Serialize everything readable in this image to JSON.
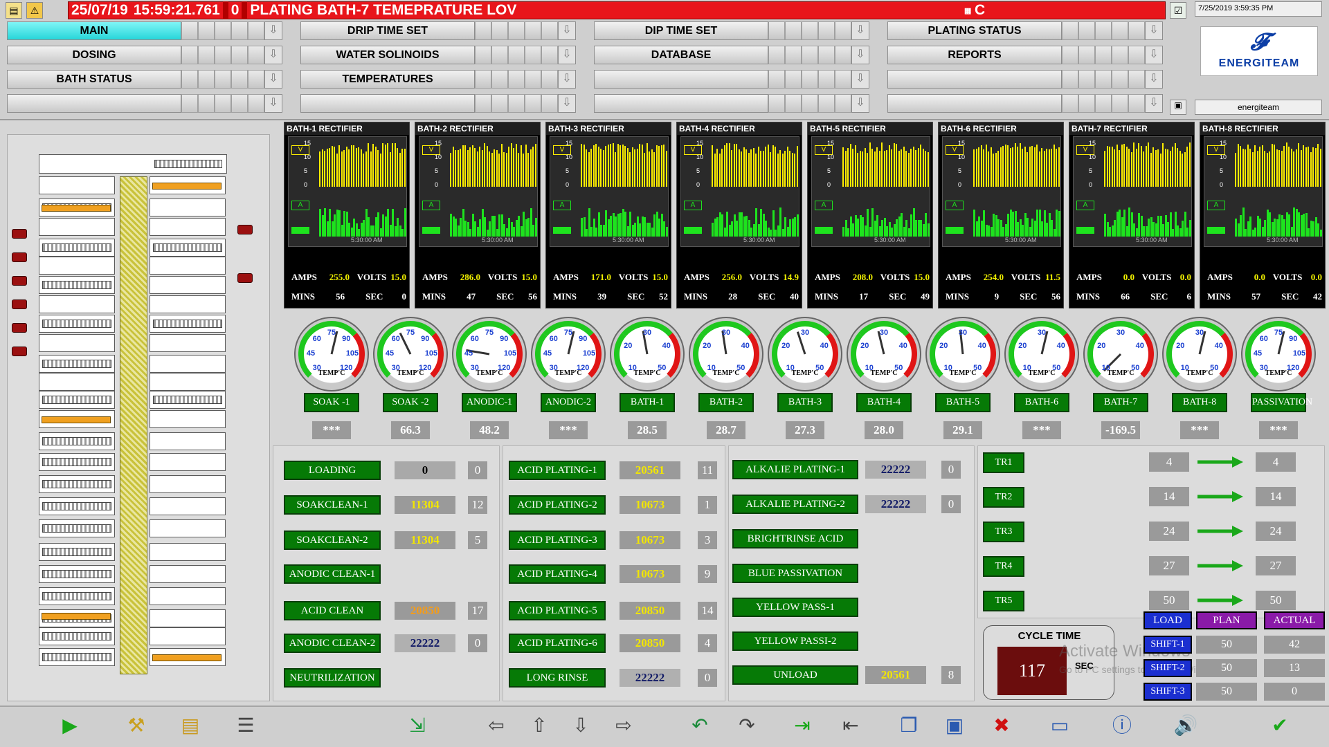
{
  "alarm": {
    "date": "25/07/19",
    "time": "15:59:21.761",
    "code": "0",
    "message": "PLATING BATH-7 TEMEPRATURE LOV",
    "extra": "C"
  },
  "system_clock": "7/25/2019 3:59:35 PM",
  "logo": {
    "name": "ENERGITEAM"
  },
  "user": "energiteam",
  "nav": {
    "rows": [
      [
        "MAIN",
        "DRIP TIME SET",
        "DIP TIME SET",
        "PLATING STATUS"
      ],
      [
        "DOSING",
        "WATER SOLINOIDS",
        "DATABASE",
        "REPORTS"
      ],
      [
        "BATH STATUS",
        "TEMPERATURES",
        "",
        ""
      ],
      [
        "",
        "",
        "",
        ""
      ]
    ],
    "active": "MAIN",
    "arrow": "⇩"
  },
  "rectifiers": [
    {
      "title": "BATH-1 RECTIFIER",
      "amps": "255.0",
      "volts": "15.0",
      "mins": "56",
      "sec": "0"
    },
    {
      "title": "BATH-2 RECTIFIER",
      "amps": "286.0",
      "volts": "15.0",
      "mins": "47",
      "sec": "56"
    },
    {
      "title": "BATH-3 RECTIFIER",
      "amps": "171.0",
      "volts": "15.0",
      "mins": "39",
      "sec": "52"
    },
    {
      "title": "BATH-4 RECTIFIER",
      "amps": "256.0",
      "volts": "14.9",
      "mins": "28",
      "sec": "40"
    },
    {
      "title": "BATH-5 RECTIFIER",
      "amps": "208.0",
      "volts": "15.0",
      "mins": "17",
      "sec": "49"
    },
    {
      "title": "BATH-6 RECTIFIER",
      "amps": "254.0",
      "volts": "11.5",
      "mins": "9",
      "sec": "56"
    },
    {
      "title": "BATH-7 RECTIFIER",
      "amps": "0.0",
      "volts": "0.0",
      "mins": "66",
      "sec": "6"
    },
    {
      "title": "BATH-8 RECTIFIER",
      "amps": "0.0",
      "volts": "0.0",
      "mins": "57",
      "sec": "42"
    }
  ],
  "rect_labels": {
    "amps": "AMPS",
    "volts": "VOLTS",
    "mins": "MINS",
    "sec": "SEC",
    "v": "V",
    "a": "A",
    "time": "5:30:00 AM",
    "vt": [
      "15",
      "10",
      "5",
      "0"
    ]
  },
  "gauges": [
    {
      "label": "SOAK -1",
      "value": "***",
      "ticks": [
        "30",
        "45",
        "60",
        "75",
        "90",
        "105",
        "120"
      ],
      "scale": "hot"
    },
    {
      "label": "SOAK -2",
      "value": "66.3",
      "ticks": [
        "30",
        "45",
        "60",
        "75",
        "90",
        "105",
        "120"
      ],
      "scale": "hot"
    },
    {
      "label": "ANODIC-1",
      "value": "48.2",
      "ticks": [
        "30",
        "45",
        "60",
        "75",
        "90",
        "105",
        "120"
      ],
      "scale": "hot"
    },
    {
      "label": "ANODIC-2",
      "value": "***",
      "ticks": [
        "30",
        "45",
        "60",
        "75",
        "90",
        "105",
        "120"
      ],
      "scale": "hot"
    },
    {
      "label": "BATH-1",
      "value": "28.5",
      "ticks": [
        "10",
        "20",
        "30",
        "40",
        "50"
      ],
      "scale": "cold"
    },
    {
      "label": "BATH-2",
      "value": "28.7",
      "ticks": [
        "10",
        "20",
        "30",
        "40",
        "50"
      ],
      "scale": "cold"
    },
    {
      "label": "BATH-3",
      "value": "27.3",
      "ticks": [
        "10",
        "20",
        "30",
        "40",
        "50"
      ],
      "scale": "cold"
    },
    {
      "label": "BATH-4",
      "value": "28.0",
      "ticks": [
        "10",
        "20",
        "30",
        "40",
        "50"
      ],
      "scale": "cold"
    },
    {
      "label": "BATH-5",
      "value": "29.1",
      "ticks": [
        "10",
        "20",
        "30",
        "40",
        "50"
      ],
      "scale": "cold"
    },
    {
      "label": "BATH-6",
      "value": "***",
      "ticks": [
        "10",
        "20",
        "30",
        "40",
        "50"
      ],
      "scale": "cold"
    },
    {
      "label": "BATH-7",
      "value": "-169.5",
      "ticks": [
        "10",
        "20",
        "30",
        "40",
        "50"
      ],
      "scale": "cold"
    },
    {
      "label": "BATH-8",
      "value": "***",
      "ticks": [
        "10",
        "20",
        "30",
        "40",
        "50"
      ],
      "scale": "cold"
    },
    {
      "label": "PASSIVATION",
      "value": "***",
      "ticks": [
        "30",
        "45",
        "60",
        "75",
        "90",
        "105",
        "120"
      ],
      "scale": "hot"
    }
  ],
  "gauge_unit": "TEMP'C",
  "process": {
    "col1": [
      {
        "label": "LOADING",
        "value": "0",
        "count": "0",
        "style": "wht"
      },
      {
        "label": "SOAKCLEAN-1",
        "value": "11304",
        "count": "12",
        "style": "yel"
      },
      {
        "label": "SOAKCLEAN-2",
        "value": "11304",
        "count": "5",
        "style": "yel"
      },
      {
        "label": "ANODIC CLEAN-1",
        "value": "",
        "count": "",
        "style": "none"
      },
      {
        "label": "ACID CLEAN",
        "value": "20850",
        "count": "17",
        "style": "org"
      },
      {
        "label": "ANODIC CLEAN-2",
        "value": "22222",
        "count": "0",
        "style": "blu"
      },
      {
        "label": "NEUTRILIZATION",
        "value": "",
        "count": "",
        "style": "none"
      }
    ],
    "col2": [
      {
        "label": "ACID PLATING-1",
        "value": "20561",
        "count": "11",
        "style": "yel"
      },
      {
        "label": "ACID PLATING-2",
        "value": "10673",
        "count": "1",
        "style": "yel"
      },
      {
        "label": "ACID PLATING-3",
        "value": "10673",
        "count": "3",
        "style": "yel"
      },
      {
        "label": "ACID PLATING-4",
        "value": "10673",
        "count": "9",
        "style": "yel"
      },
      {
        "label": "ACID PLATING-5",
        "value": "20850",
        "count": "14",
        "style": "yel"
      },
      {
        "label": "ACID PLATING-6",
        "value": "20850",
        "count": "4",
        "style": "yel"
      },
      {
        "label": "LONG RINSE",
        "value": "22222",
        "count": "0",
        "style": "blu"
      }
    ],
    "col3": [
      {
        "label": "ALKALIE PLATING-1",
        "value": "22222",
        "count": "0",
        "style": "blu"
      },
      {
        "label": "ALKALIE PLATING-2",
        "value": "22222",
        "count": "0",
        "style": "blu"
      },
      {
        "label": "BRIGHTRINSE ACID",
        "value": "",
        "count": "",
        "style": "none"
      },
      {
        "label": "BLUE PASSIVATION",
        "value": "",
        "count": "",
        "style": "none"
      },
      {
        "label": "YELLOW PASS-1",
        "value": "",
        "count": "",
        "style": "none"
      },
      {
        "label": "YELLOW PASSI-2",
        "value": "",
        "count": "",
        "style": "none"
      },
      {
        "label": "UNLOAD",
        "value": "20561",
        "count": "8",
        "style": "yel"
      }
    ]
  },
  "transfer": [
    {
      "label": "TR1",
      "from": "4",
      "to": "4"
    },
    {
      "label": "TR2",
      "from": "14",
      "to": "14"
    },
    {
      "label": "TR3",
      "from": "24",
      "to": "24"
    },
    {
      "label": "TR4",
      "from": "27",
      "to": "27"
    },
    {
      "label": "TR5",
      "from": "50",
      "to": "50"
    }
  ],
  "cycle": {
    "title": "CYCLE TIME",
    "value": "117",
    "unit": "SEC"
  },
  "shifts": {
    "headers": [
      "LOAD",
      "PLAN",
      "ACTUAL"
    ],
    "rows": [
      {
        "label": "SHIFT-1",
        "plan": "50",
        "actual": "42"
      },
      {
        "label": "SHIFT-2",
        "plan": "50",
        "actual": "13"
      },
      {
        "label": "SHIFT-3",
        "plan": "50",
        "actual": "0"
      }
    ]
  },
  "watermark": {
    "line1": "Activate Windows",
    "line2": "Go to PC settings to activate Windows."
  },
  "colors": {
    "alarm": "#e8151b",
    "green_button": "#067a06",
    "active_nav": "#27d6d9",
    "load": "#1b2fd0",
    "plan": "#8a1aa8"
  }
}
